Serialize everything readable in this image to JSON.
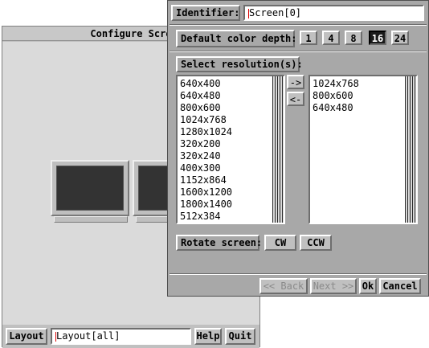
{
  "back_window": {
    "title": "Configure Scre",
    "layout_button": "Layout",
    "layout_field": "ayout[all]",
    "layout_field_first": "L",
    "help_button": "Help",
    "quit_button": "Quit"
  },
  "dialog": {
    "identifier_label": "Identifier:",
    "identifier_first": "S",
    "identifier_value": "creen[0]",
    "color_depth_label": "Default color depth:",
    "color_depths": [
      "1",
      "4",
      "8",
      "16",
      "24"
    ],
    "selected_depth": "16",
    "select_resolution_label": "Select resolution(s):",
    "available_resolutions": [
      "640x400",
      "640x480",
      "800x600",
      "1024x768",
      "1280x1024",
      "320x200",
      "320x240",
      "400x300",
      "1152x864",
      "1600x1200",
      "1800x1400",
      "512x384"
    ],
    "add_arrow": "->",
    "remove_arrow": "<-",
    "selected_resolutions": [
      "1024x768",
      "800x600",
      "640x480"
    ],
    "rotate_label": "Rotate screen:",
    "cw_button": "CW",
    "ccw_button": "CCW",
    "back_button": "<< Back",
    "next_button": "Next >>",
    "ok_button": "Ok",
    "cancel_button": "Cancel"
  }
}
